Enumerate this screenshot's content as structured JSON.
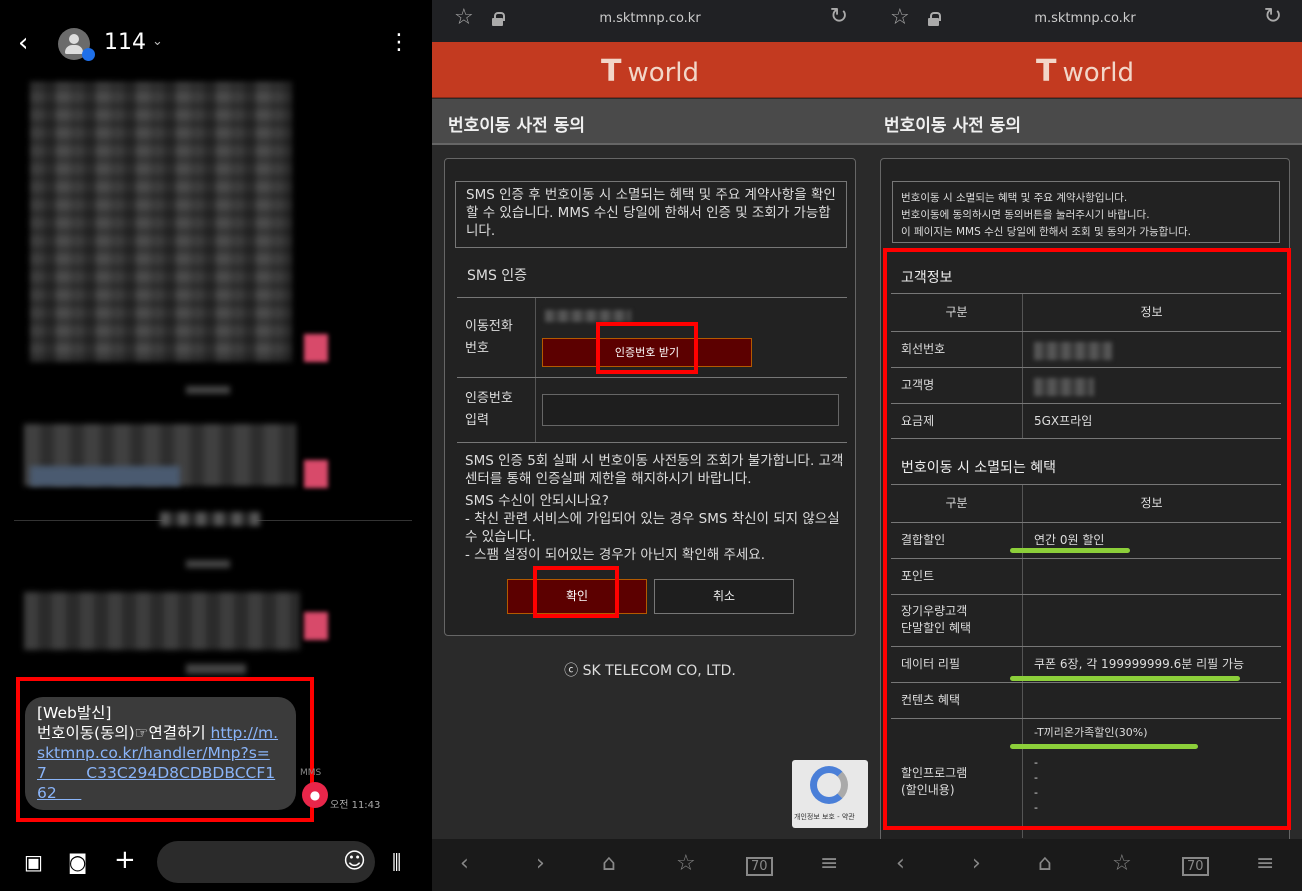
{
  "sms": {
    "contact": "114",
    "bubble": {
      "tag": "[Web발신]",
      "text": "번호이동(동의)☞연결하기 ",
      "link": "http://m.sktmnp.co.kr/handler/Mnp?s=7        C33C294D8CDBDBCCF162     "
    },
    "badge": "MMS",
    "time": "오전 11:43",
    "icons": {
      "back": "back-arrow-icon",
      "menu": "more-vert-icon",
      "gallery": "gallery-icon",
      "camera": "camera-icon",
      "add": "plus-icon",
      "emoji": "emoji-icon",
      "voice": "voice-icon"
    }
  },
  "browser": {
    "url": "m.sktmnp.co.kr",
    "logo": "world",
    "page_title": "번호이동 사전 동의",
    "footer": "ⓒ SK TELECOM CO, LTD."
  },
  "consent": {
    "notice": "SMS 인증 후 번호이동 시 소멸되는 혜택 및 주요 계약사항을 확인할 수 있습니다. MMS 수신 당일에 한해서 인증 및 조회가 가능합니다.",
    "sms_title": "SMS 인증",
    "phone_label": "이동전화\n번호",
    "get_code_button": "인증번호 받기",
    "code_label": "인증번호\n입력",
    "note": "SMS 인증 5회 실패 시 번호이동 사전동의 조회가 불가합니다. 고객센터를 통해 인증실패 제한을 해지하시기 바랍니다.",
    "note2": "SMS 수신이 안되시나요?\n- 착신 관련 서비스에 가입되어 있는 경우 SMS 착신이 되지 않으실 수 있습니다.\n- 스팸 설정이 되어있는 경우가 아닌지 확인해 주세요.",
    "ok_button": "확인",
    "cancel_button": "취소",
    "recaptcha": "개인정보 보호 - 약관"
  },
  "result": {
    "notice": "번호이동 시 소멸되는 혜택 및 주요 계약사항입니다.\n번호이동에 동의하시면 동의버튼을 눌러주시기 바랍니다.\n이 페이지는 MMS 수신 당일에 한해서 조회 및 동의가 가능합니다.",
    "customer_title": "고객정보",
    "col1": "구분",
    "col2": "정보",
    "customer_rows": [
      {
        "label": "회선번호",
        "value": ""
      },
      {
        "label": "고객명",
        "value": ""
      },
      {
        "label": "요금제",
        "value": "5GX프라임"
      }
    ],
    "benefit_title": "번호이동 시 소멸되는 혜택",
    "benefit_rows": [
      {
        "label": "결합할인",
        "value": "연간 0원 할인"
      },
      {
        "label": "포인트",
        "value": ""
      },
      {
        "label": "장기우량고객\n단말할인 혜택",
        "value": ""
      },
      {
        "label": "데이터 리필",
        "value": "쿠폰 6장, 각 199999999.6분 리필 가능"
      },
      {
        "label": "컨텐츠 혜택",
        "value": ""
      },
      {
        "label": "할인프로그램\n(할인내용)",
        "value": "-T끼리온가족할인(30%)\n-\n-\n-\n-\n-"
      }
    ]
  },
  "nav_icons": [
    "back-icon",
    "forward-icon",
    "home-icon",
    "bookmark-icon",
    "tabs-icon",
    "menu-icon"
  ],
  "tabs_count": "70",
  "colors": {
    "brand_red": "#c33a20",
    "highlight": "#ff0000",
    "underline": "#8ccf3a",
    "button_dark_red": "#5c0000"
  }
}
